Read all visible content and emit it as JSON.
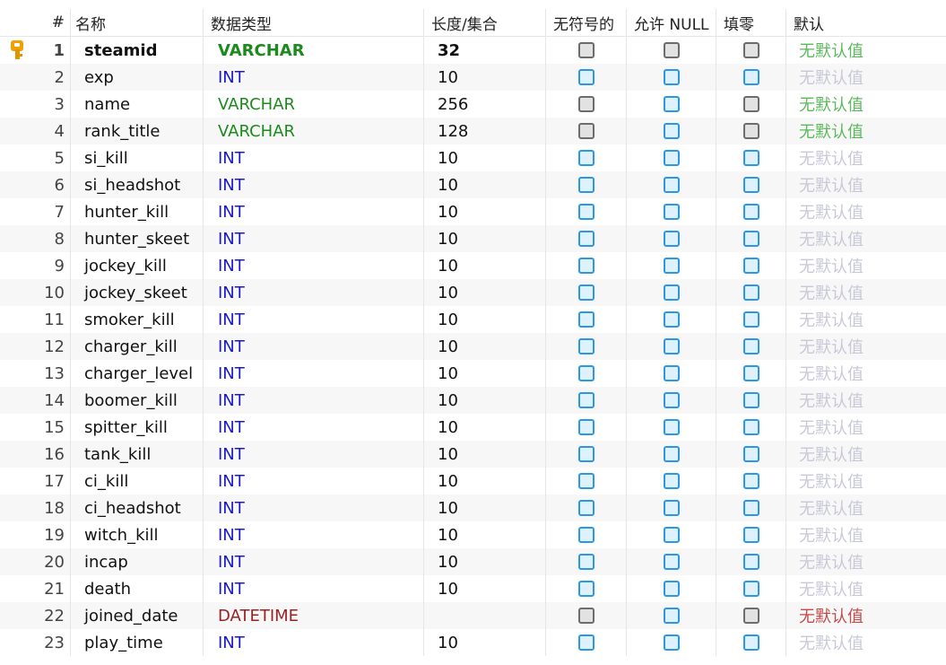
{
  "header": {
    "num": "#",
    "name": "名称",
    "type": "数据类型",
    "length": "长度/集合",
    "unsigned": "无符号的",
    "allow_null": "允许 NULL",
    "zerofill": "填零",
    "default": "默认"
  },
  "icons": {
    "primary_key": "key-icon",
    "checkbox": "checkbox-icon"
  },
  "colors": {
    "varchar": "#1c8a1c",
    "int": "#1a1acc",
    "datetime": "#992222",
    "checkbox_on": "#2b97e8",
    "checkbox_off": "#6c6c6c"
  },
  "rows": [
    {
      "num": "1",
      "name": "steamid",
      "type": "VARCHAR",
      "length": "32",
      "unsigned": false,
      "allow_null": false,
      "zerofill": false,
      "default": "无默认值",
      "primary": true
    },
    {
      "num": "2",
      "name": "exp",
      "type": "INT",
      "length": "10",
      "unsigned": true,
      "allow_null": true,
      "zerofill": true,
      "default": "无默认值"
    },
    {
      "num": "3",
      "name": "name",
      "type": "VARCHAR",
      "length": "256",
      "unsigned": false,
      "allow_null": true,
      "zerofill": false,
      "default": "无默认值"
    },
    {
      "num": "4",
      "name": "rank_title",
      "type": "VARCHAR",
      "length": "128",
      "unsigned": false,
      "allow_null": true,
      "zerofill": false,
      "default": "无默认值"
    },
    {
      "num": "5",
      "name": "si_kill",
      "type": "INT",
      "length": "10",
      "unsigned": true,
      "allow_null": true,
      "zerofill": true,
      "default": "无默认值"
    },
    {
      "num": "6",
      "name": "si_headshot",
      "type": "INT",
      "length": "10",
      "unsigned": true,
      "allow_null": true,
      "zerofill": true,
      "default": "无默认值"
    },
    {
      "num": "7",
      "name": "hunter_kill",
      "type": "INT",
      "length": "10",
      "unsigned": true,
      "allow_null": true,
      "zerofill": true,
      "default": "无默认值"
    },
    {
      "num": "8",
      "name": "hunter_skeet",
      "type": "INT",
      "length": "10",
      "unsigned": true,
      "allow_null": true,
      "zerofill": true,
      "default": "无默认值"
    },
    {
      "num": "9",
      "name": "jockey_kill",
      "type": "INT",
      "length": "10",
      "unsigned": true,
      "allow_null": true,
      "zerofill": true,
      "default": "无默认值"
    },
    {
      "num": "10",
      "name": "jockey_skeet",
      "type": "INT",
      "length": "10",
      "unsigned": true,
      "allow_null": true,
      "zerofill": true,
      "default": "无默认值"
    },
    {
      "num": "11",
      "name": "smoker_kill",
      "type": "INT",
      "length": "10",
      "unsigned": true,
      "allow_null": true,
      "zerofill": true,
      "default": "无默认值"
    },
    {
      "num": "12",
      "name": "charger_kill",
      "type": "INT",
      "length": "10",
      "unsigned": true,
      "allow_null": true,
      "zerofill": true,
      "default": "无默认值"
    },
    {
      "num": "13",
      "name": "charger_level",
      "type": "INT",
      "length": "10",
      "unsigned": true,
      "allow_null": true,
      "zerofill": true,
      "default": "无默认值"
    },
    {
      "num": "14",
      "name": "boomer_kill",
      "type": "INT",
      "length": "10",
      "unsigned": true,
      "allow_null": true,
      "zerofill": true,
      "default": "无默认值"
    },
    {
      "num": "15",
      "name": "spitter_kill",
      "type": "INT",
      "length": "10",
      "unsigned": true,
      "allow_null": true,
      "zerofill": true,
      "default": "无默认值"
    },
    {
      "num": "16",
      "name": "tank_kill",
      "type": "INT",
      "length": "10",
      "unsigned": true,
      "allow_null": true,
      "zerofill": true,
      "default": "无默认值"
    },
    {
      "num": "17",
      "name": "ci_kill",
      "type": "INT",
      "length": "10",
      "unsigned": true,
      "allow_null": true,
      "zerofill": true,
      "default": "无默认值"
    },
    {
      "num": "18",
      "name": "ci_headshot",
      "type": "INT",
      "length": "10",
      "unsigned": true,
      "allow_null": true,
      "zerofill": true,
      "default": "无默认值"
    },
    {
      "num": "19",
      "name": "witch_kill",
      "type": "INT",
      "length": "10",
      "unsigned": true,
      "allow_null": true,
      "zerofill": true,
      "default": "无默认值"
    },
    {
      "num": "20",
      "name": "incap",
      "type": "INT",
      "length": "10",
      "unsigned": true,
      "allow_null": true,
      "zerofill": true,
      "default": "无默认值"
    },
    {
      "num": "21",
      "name": "death",
      "type": "INT",
      "length": "10",
      "unsigned": true,
      "allow_null": true,
      "zerofill": true,
      "default": "无默认值"
    },
    {
      "num": "22",
      "name": "joined_date",
      "type": "DATETIME",
      "length": "",
      "unsigned": false,
      "allow_null": true,
      "zerofill": false,
      "default": "无默认值"
    },
    {
      "num": "23",
      "name": "play_time",
      "type": "INT",
      "length": "10",
      "unsigned": true,
      "allow_null": true,
      "zerofill": true,
      "default": "无默认值"
    }
  ]
}
